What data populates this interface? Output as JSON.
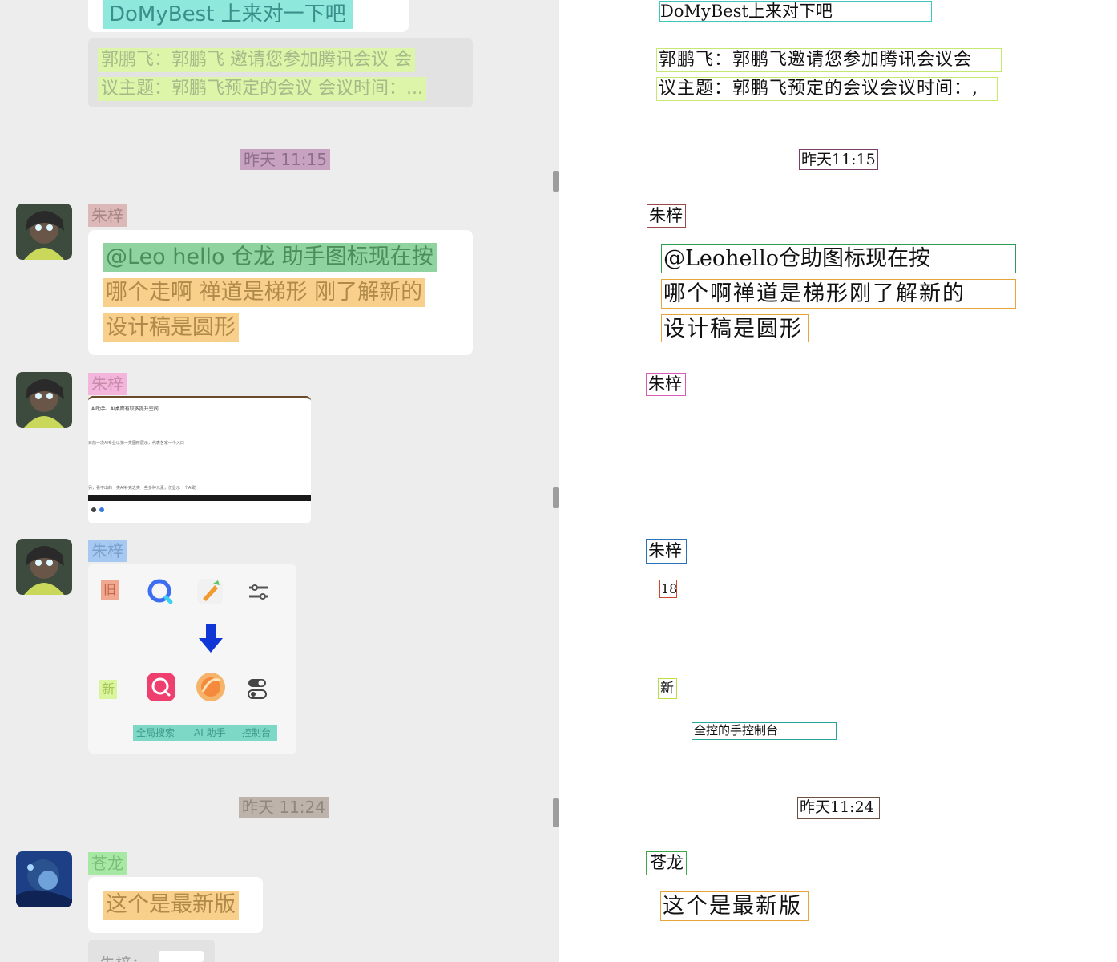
{
  "chat": {
    "top_bubble_text": "DoMyBest 上来对一下吧",
    "quote_line1": "郭鹏飞：郭鹏飞 邀请您参加腾讯会议 会",
    "quote_line2": "议主题：郭鹏飞预定的会议 会议时间：...",
    "timestamp1": "昨天 11:15",
    "msg1": {
      "sender": "朱梓",
      "line1": "@Leo hello 仓龙 助手图标现在按",
      "line2": "哪个走啊  禅道是梯形 刚了解新的",
      "line3": "设计稿是圆形"
    },
    "msg2": {
      "sender": "朱梓",
      "thumb_line1": "AI助手、AI桌面有较多提升空间",
      "thumb_line2": "目前一次AI专业以第一类图形展示，代表各家一个入口",
      "thumb_line3": "另，看不出的一类AI补充之类一些多种元素，仅显示一个AI助"
    },
    "msg3": {
      "sender": "朱梓",
      "old_label": "旧",
      "new_label": "新",
      "caption_search": "全局搜索",
      "caption_ai": "AI 助手",
      "caption_console": "控制台"
    },
    "timestamp2": "昨天 11:24",
    "msg4": {
      "sender": "苍龙",
      "line1": "这个是最新版"
    },
    "partial_reply": "朱梓："
  },
  "annotations": {
    "top_text": "DoMyBest上来对下吧",
    "quote_line1": "郭鹏飞：郭鹏飞邀请您参加腾讯会议会",
    "quote_line2": "议主题：郭鹏飞预定的会议会议时间：,",
    "timestamp1": "昨天11:15",
    "sender1": "朱梓",
    "msg1_line1": "@Leohello仓助图标现在按",
    "msg1_line2": "哪个啊禅道是梯形刚了解新的",
    "msg1_line3": "设计稿是圆形",
    "sender2": "朱梓",
    "sender3": "朱梓",
    "old_label": "18",
    "new_label": "新",
    "caption": "全控的手控制台",
    "timestamp2": "昨天11:24",
    "sender4": "苍龙",
    "msg4_line1": "这个是最新版"
  },
  "colors": {
    "top_highlight": "#8ee8dc",
    "quote_highlight": "#dcf5a8",
    "timestamp1_highlight": "#c7a3c1",
    "sender1_highlight": "#dcb8b8",
    "msg1_line1_highlight": "#8fd4a0",
    "msg_orange_highlight": "#f8d08c",
    "sender2_highlight": "#f3b5dc",
    "sender3_highlight": "#a6c9f2",
    "old_chip": "#f0a890",
    "new_chip": "#d9f59e",
    "caption_highlight": "#7ed8c6",
    "timestamp2_highlight": "#bdb3aa",
    "sender4_highlight": "#a7e8a5",
    "ann_top_border": "#3fc6bd",
    "ann_quote_border": "#c5e870",
    "ann_ts_border": "#7a3e6e",
    "ann_sender1_border": "#9a4a4a",
    "ann_msg1_l1_border": "#2e9c54",
    "ann_msg_orange_border": "#e6a53a",
    "ann_sender2_border": "#d85cb5",
    "ann_sender3_border": "#2a72b8",
    "ann_old_border": "#c84a2a",
    "ann_new_border": "#b7e040",
    "ann_caption_border": "#27a39a",
    "ann_ts2_border": "#6d5141",
    "ann_sender4_border": "#3aa84a"
  }
}
